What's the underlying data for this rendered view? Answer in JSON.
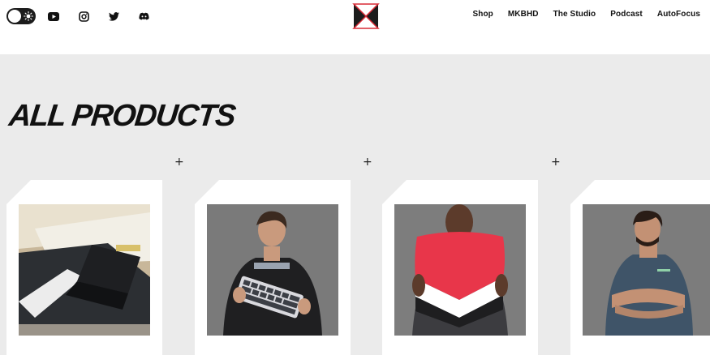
{
  "header": {
    "theme_toggle": {
      "icon": "sun-icon"
    },
    "social": [
      "youtube-icon",
      "instagram-icon",
      "twitter-icon",
      "discord-icon"
    ],
    "logo": "mkbhd-logo",
    "nav": [
      "Shop",
      "MKBHD",
      "The Studio",
      "Podcast",
      "AutoFocus"
    ]
  },
  "main": {
    "title": "ALL PRODUCTS"
  },
  "products": [
    {
      "image": "laptop-deskmat-photo"
    },
    {
      "image": "keyboard-model-photo"
    },
    {
      "image": "pillow-model-photo"
    },
    {
      "image": "tshirt-model-photo"
    }
  ],
  "colors": {
    "accent_red": "#d92a35",
    "page_bg": "#ebebeb",
    "text": "#111111"
  }
}
